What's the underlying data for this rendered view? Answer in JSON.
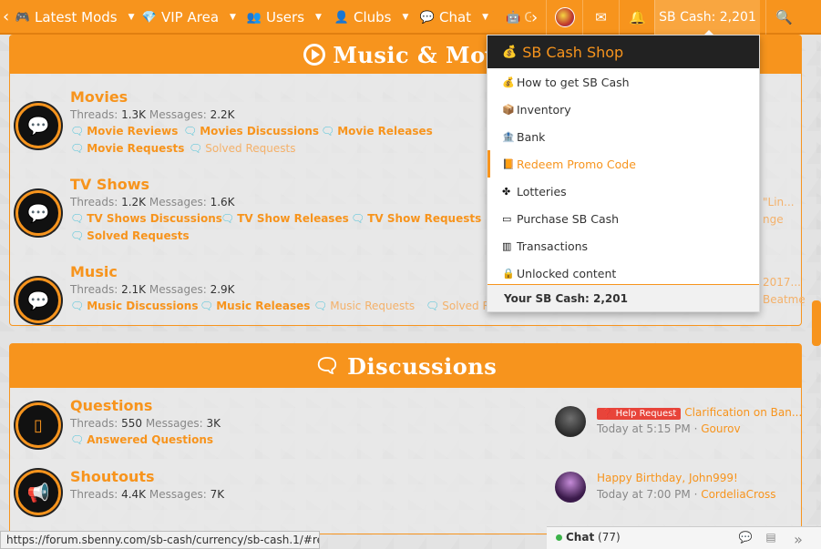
{
  "nav": {
    "items": [
      {
        "icon": "🎮",
        "label": "Latest Mods"
      },
      {
        "icon": "💎",
        "label": "VIP Area"
      },
      {
        "icon": "👥",
        "label": "Users"
      },
      {
        "icon": "👤",
        "label": "Clubs"
      },
      {
        "icon": "💬",
        "label": "Chat"
      },
      {
        "icon": "🤖",
        "label": "G"
      }
    ],
    "cash_label": "SB Cash: 2,201"
  },
  "dropdown": {
    "title": "SB Cash Shop",
    "items": [
      {
        "icon": "💰",
        "label": "How to get SB Cash"
      },
      {
        "icon": "📦",
        "label": "Inventory"
      },
      {
        "icon": "🏦",
        "label": "Bank"
      },
      {
        "icon": "📙",
        "label": "Redeem Promo Code",
        "active": true
      },
      {
        "icon": "✤",
        "label": "Lotteries"
      },
      {
        "icon": "▭",
        "label": "Purchase SB Cash"
      },
      {
        "icon": "▥",
        "label": "Transactions"
      },
      {
        "icon": "🔒",
        "label": "Unlocked content"
      }
    ],
    "footer": "Your SB Cash: 2,201"
  },
  "music_panel": {
    "title": "Music & Movi",
    "forums": [
      {
        "title": "Movies",
        "threads_label": "Threads:",
        "threads": "1.3K",
        "messages_label": "Messages:",
        "messages": "2.2K",
        "subs": [
          "Movie Reviews",
          "Movies Discussions",
          "Movie Releases",
          "Movie Requests",
          "Solved Requests"
        ]
      },
      {
        "title": "TV Shows",
        "threads_label": "Threads:",
        "threads": "1.2K",
        "messages_label": "Messages:",
        "messages": "1.6K",
        "subs": [
          "TV Shows Discussions",
          "TV Show Releases",
          "TV Show Requests",
          "Solved Requests"
        ],
        "right_fragments": [
          "\"Lin...",
          "nge"
        ]
      },
      {
        "title": "Music",
        "threads_label": "Threads:",
        "threads": "2.1K",
        "messages_label": "Messages:",
        "messages": "2.9K",
        "subs": [
          "Music Discussions",
          "Music Releases",
          "Music Requests",
          "Solved R"
        ],
        "right_fragments": [
          "2017...",
          "Beatme"
        ]
      }
    ]
  },
  "discussions_panel": {
    "title": "Discussions",
    "forums": [
      {
        "title": "Questions",
        "threads_label": "Threads:",
        "threads": "550",
        "messages_label": "Messages:",
        "messages": "3K",
        "subs": [
          "Answered Questions"
        ],
        "latest": {
          "badge": "Help Request",
          "title": "Clarification on Ban...",
          "time": "Today at 5:15 PM",
          "user": "Gourov"
        }
      },
      {
        "title": "Shoutouts",
        "threads_label": "Threads:",
        "threads": "4.4K",
        "messages_label": "Messages:",
        "messages": "7K",
        "latest": {
          "title": "Happy Birthday, John999!",
          "time": "Today at 7:00 PM",
          "user": "CordeliaCross"
        }
      }
    ]
  },
  "status_url": "https://forum.sbenny.com/sb-cash/currency/sb-cash.1/#redeem",
  "bottom": {
    "chat_label": "Chat",
    "chat_count": "(77)"
  },
  "colors": {
    "accent": "#f7941d",
    "dark": "#222222",
    "link_icon": "#4fc3d9",
    "badge": "#e8443a"
  }
}
